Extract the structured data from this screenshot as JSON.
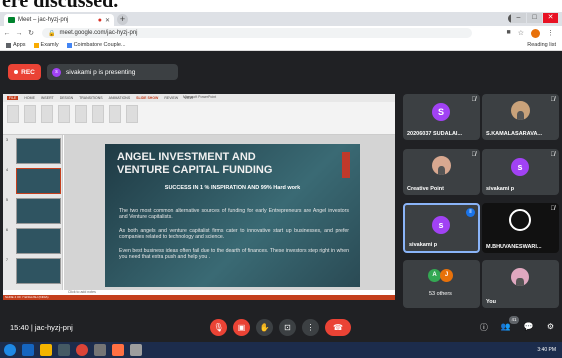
{
  "page_header_fragment": "ere discussed.",
  "browser": {
    "tab_title": "Meet – jac-hyzj-pnj",
    "new_tab": "+",
    "url": "meet.google.com/jac-hyzj-pnj",
    "bookmarks": [
      {
        "label": "Apps"
      },
      {
        "label": "Examly"
      },
      {
        "label": "Coimbatore Couple..."
      }
    ],
    "reading_list": "Reading list"
  },
  "meet": {
    "rec_label": "REC",
    "presenter_initial": "s",
    "presenting_text": "sivakami p is presenting",
    "meeting_time_code": "15:40  |  jac-hyzj-pnj",
    "people_badge": "41"
  },
  "powerpoint": {
    "ribbon_tabs": [
      "FILE",
      "HOME",
      "INSERT",
      "DESIGN",
      "TRANSITIONS",
      "ANIMATIONS",
      "SLIDE SHOW",
      "REVIEW",
      "VIEW"
    ],
    "window_title": "Microsoft PowerPoint",
    "notes_placeholder": "Click to add notes",
    "status_text": "SLIDE 4 OF 7   ENGLISH (INDIA)",
    "slide": {
      "title_line1": "ANGEL INVESTMENT AND",
      "title_line2": "VENTURE CAPITAL FUNDING",
      "subtitle": "SUCCESS IN 1 % INSPIRATION AND 99% Hard work",
      "paragraphs": [
        "The two most common alternative sources of funding for early Entrepreneurs are Angel investors and Venture capitalists.",
        "As both angels and venture capitalist firms cater to innovative start up businesses, and prefer companies related to technology and science.",
        "Even best business ideas often fail due to the dearth of finances. These investors step right in when you need that extra push and help you ."
      ]
    },
    "thumb_numbers": [
      "3",
      "4",
      "5",
      "6",
      "7"
    ]
  },
  "participants": [
    {
      "name": "20206037 SUDALAI...",
      "initial": "S",
      "color": "#a142f4"
    },
    {
      "name": "S.KAMALASARAVA..."
    },
    {
      "name": "Creative Point"
    },
    {
      "name": "sivakami p",
      "initial": "s",
      "color": "#a142f4"
    },
    {
      "name": "sivakami p",
      "initial": "s",
      "color": "#a142f4"
    },
    {
      "name": "M.BHUVANESWARI..."
    },
    {
      "name": "53 others",
      "initial_a": "A",
      "initial_b": "J"
    },
    {
      "name": "You"
    }
  ],
  "colors": {
    "accent_red": "#ea4335",
    "meet_bg": "#202124",
    "tile_bg": "#3c4043",
    "avatar_purple": "#a142f4"
  },
  "taskbar": {
    "time": "3:40 PM"
  }
}
